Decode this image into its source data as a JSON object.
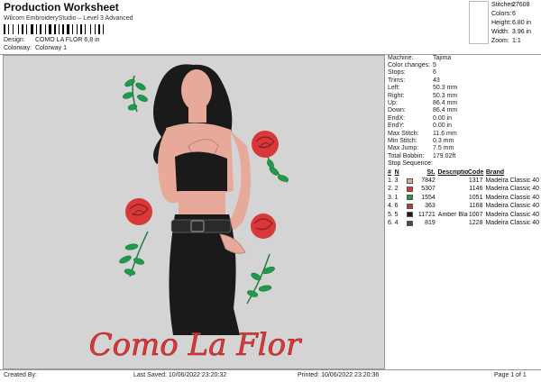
{
  "header": {
    "title": "Production Worksheet",
    "subtitle": "Wilcom EmbroideryStudio – Level 3 Advanced",
    "design_label": "Design:",
    "design_value": "COMO LA FLOR 6,8 in",
    "colorway_label": "Colorway:",
    "colorway_value": "Colorway 1"
  },
  "summary": {
    "stitches_label": "Stitches:",
    "stitches": "27608",
    "colors_label": "Colors:",
    "colors": "6",
    "height_label": "Height:",
    "height": "6.80 in",
    "width_label": "Width:",
    "width": "3.96 in",
    "zoom_label": "Zoom:",
    "zoom": "1:1"
  },
  "machine_info": [
    {
      "label": "Machine:",
      "value": "Tajima"
    },
    {
      "label": "Color changes:",
      "value": "5"
    },
    {
      "label": "Stops:",
      "value": "6"
    },
    {
      "label": "Trims:",
      "value": "43"
    },
    {
      "label": "Left:",
      "value": "50.3 mm"
    },
    {
      "label": "Right:",
      "value": "50.3 mm"
    },
    {
      "label": "Up:",
      "value": "86.4 mm"
    },
    {
      "label": "Down:",
      "value": "86.4 mm"
    },
    {
      "label": "EndX:",
      "value": "0.00 in"
    },
    {
      "label": "EndY:",
      "value": "0.00 in"
    },
    {
      "label": "Max Stitch:",
      "value": "11.6 mm"
    },
    {
      "label": "Min Stitch:",
      "value": "0.3 mm"
    },
    {
      "label": "Max Jump:",
      "value": "7.5 mm"
    },
    {
      "label": "Total Bobbin:",
      "value": "179.02ft"
    }
  ],
  "stop_sequence": {
    "title": "Stop Sequence:",
    "headers": {
      "num": "#",
      "n": "N",
      "st": "St.",
      "description": "Description",
      "code": "Code",
      "brand": "Brand"
    },
    "rows": [
      {
        "num": "1.",
        "n": "3",
        "color": "#e7a99a",
        "st": "7842",
        "description": "",
        "code": "1317",
        "brand": "Madeira Classic 40"
      },
      {
        "num": "2.",
        "n": "2",
        "color": "#d8383a",
        "st": "5307",
        "description": "",
        "code": "1146",
        "brand": "Madeira Classic 40"
      },
      {
        "num": "3.",
        "n": "1",
        "color": "#1e9a4a",
        "st": "1554",
        "description": "",
        "code": "1051",
        "brand": "Madeira Classic 40"
      },
      {
        "num": "4.",
        "n": "6",
        "color": "#b23a38",
        "st": "363",
        "description": "",
        "code": "1168",
        "brand": "Madeira Classic 40"
      },
      {
        "num": "5.",
        "n": "5",
        "color": "#1a1a1a",
        "st": "11721",
        "description": "Amber Black",
        "code": "1007",
        "brand": "Madeira Classic 40"
      },
      {
        "num": "6.",
        "n": "4",
        "color": "#4a4a3a",
        "st": "819",
        "description": "",
        "code": "1228",
        "brand": "Madeira Classic 40"
      }
    ]
  },
  "design": {
    "caption": "Como La Flor"
  },
  "footer": {
    "created_by": "Created By:",
    "last_saved": "Last Saved: 10/06/2022 23:20:32",
    "printed": "Printed: 10/06/2022 23:20:36",
    "page": "Page 1 of 1"
  },
  "colors": {
    "skin": "#e7a99a",
    "rose": "#d8383a",
    "leaf": "#1e9a4a",
    "hair": "#1a1a1a",
    "background": "#d4d4d4"
  }
}
